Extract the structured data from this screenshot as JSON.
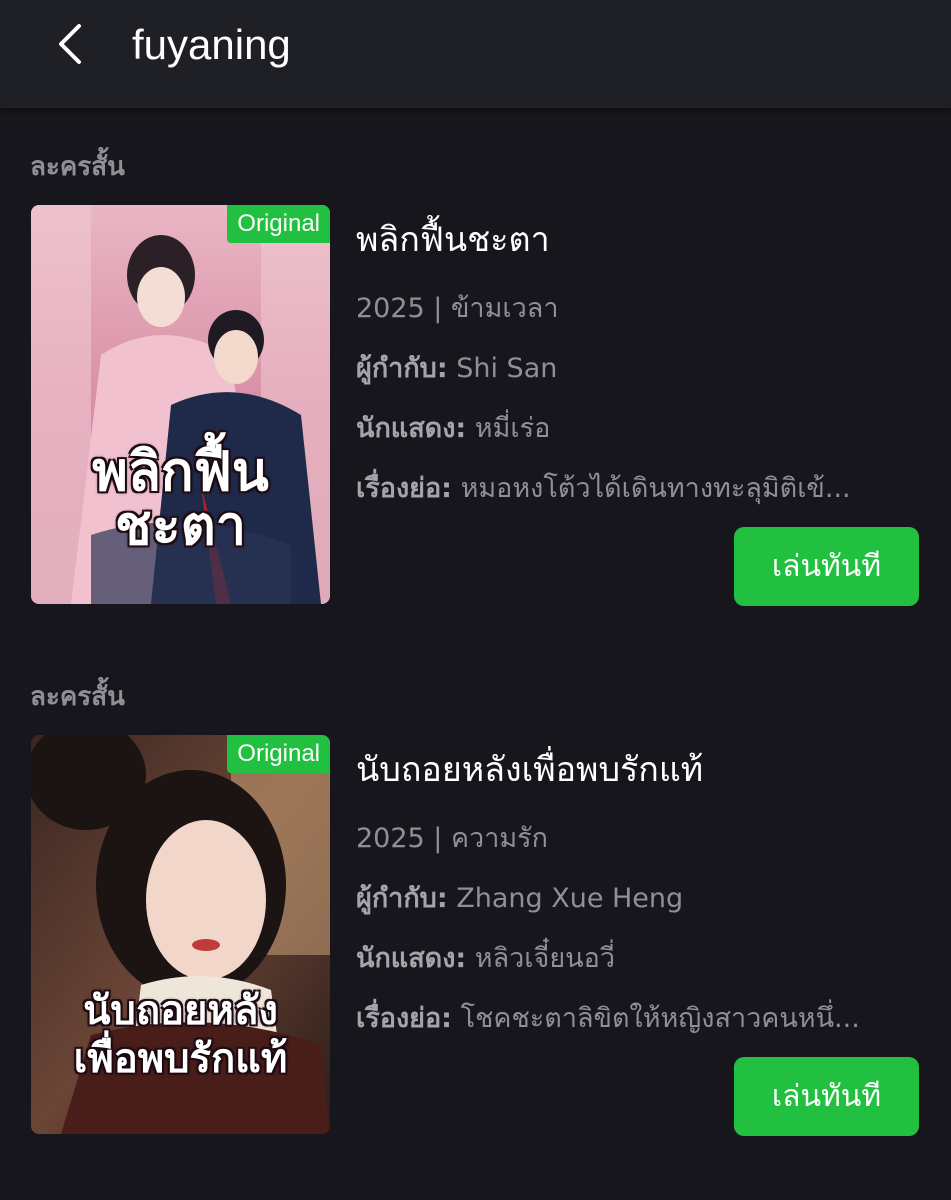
{
  "header": {
    "title": "fuyaning",
    "back_icon": "chevron-left-icon"
  },
  "results": [
    {
      "section_label": "ละครสั้น",
      "badge": "Original",
      "poster_text_line1": "พลิกฟื้น",
      "poster_text_line2": "ชะตา",
      "title": "พลิกฟื้นชะตา",
      "year_genre": "2025 | ข้ามเวลา",
      "director_label": "ผู้กำกับ:",
      "director": "Shi San",
      "cast_label": "นักแสดง:",
      "cast": "หมี่เร่อ",
      "synopsis_label": "เรื่องย่อ:",
      "synopsis": "หมอหงโต้วได้เดินทางทะลุมิติเข้...",
      "play_label": "เล่นทันที"
    },
    {
      "section_label": "ละครสั้น",
      "badge": "Original",
      "poster_text_line1": "นับถอยหลัง",
      "poster_text_line2": "เพื่อพบรักแท้",
      "title": "นับถอยหลังเพื่อพบรักแท้",
      "year_genre": "2025 | ความรัก",
      "director_label": "ผู้กำกับ:",
      "director": "Zhang Xue Heng",
      "cast_label": "นักแสดง:",
      "cast": "หลิวเจี๋ยนอวี่",
      "synopsis_label": "เรื่องย่อ:",
      "synopsis": "โชคชะตาลิขิตให้หญิงสาวคนหนึ่...",
      "play_label": "เล่นทันที"
    }
  ],
  "colors": {
    "accent_green": "#22c041",
    "background": "#16161c",
    "header_bg": "#1f1f26",
    "muted_text": "#8f8f96"
  }
}
